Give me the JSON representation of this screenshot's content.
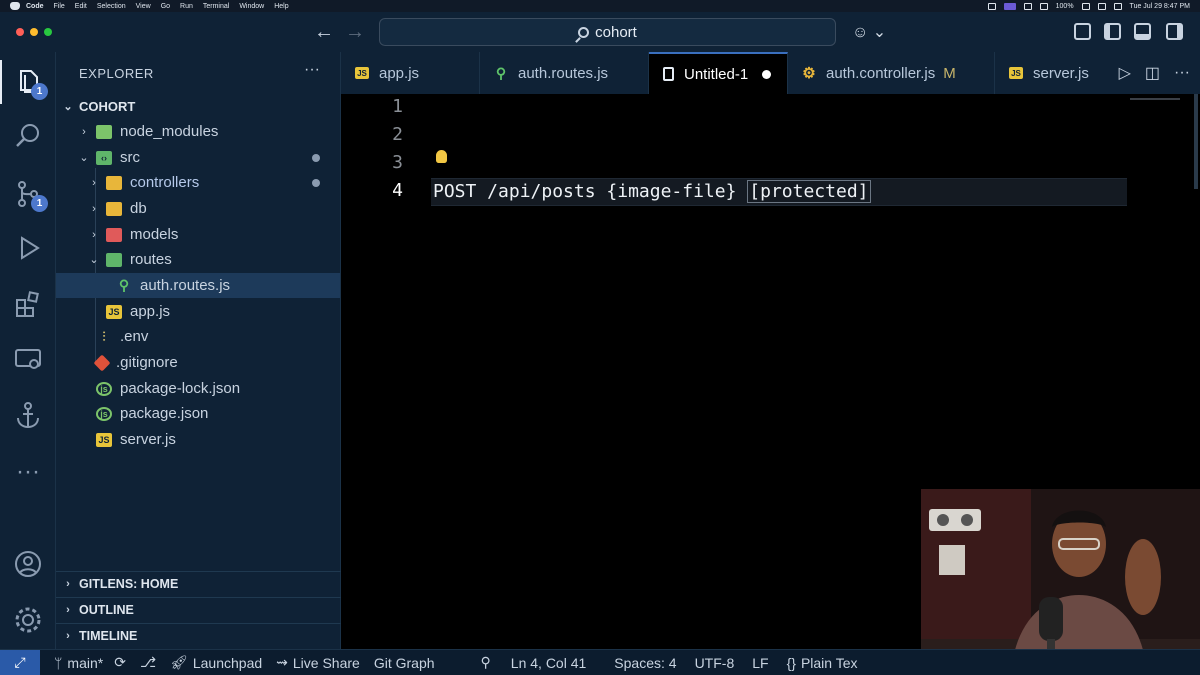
{
  "menubar": {
    "app": "Code",
    "items": [
      "File",
      "Edit",
      "Selection",
      "View",
      "Go",
      "Run",
      "Terminal",
      "Window",
      "Help"
    ],
    "battery": "100%",
    "clock": "Tue Jul 29  8:47 PM"
  },
  "titlebar": {
    "search": "cohort"
  },
  "activity": {
    "explorer_badge": "1",
    "scm_badge": "1"
  },
  "sidebar": {
    "title": "EXPLORER",
    "more": "···",
    "root": "COHORT",
    "items": [
      {
        "label": "node_modules"
      },
      {
        "label": "src"
      },
      {
        "label": "controllers"
      },
      {
        "label": "db"
      },
      {
        "label": "models"
      },
      {
        "label": "routes"
      },
      {
        "label": "auth.routes.js"
      },
      {
        "label": "app.js"
      },
      {
        "label": ".env"
      },
      {
        "label": ".gitignore"
      },
      {
        "label": "package-lock.json"
      },
      {
        "label": "package.json"
      },
      {
        "label": "server.js"
      }
    ],
    "sections": [
      "GITLENS: HOME",
      "OUTLINE",
      "TIMELINE"
    ]
  },
  "tabs": [
    {
      "label": "app.js"
    },
    {
      "label": "auth.routes.js"
    },
    {
      "label": "Untitled-1"
    },
    {
      "label": "auth.controller.js",
      "flag": "M"
    },
    {
      "label": "server.js"
    }
  ],
  "editor": {
    "line_numbers": [
      "1",
      "2",
      "3",
      "4"
    ],
    "code_a": "POST /api/posts {image-file} ",
    "code_b": "[protected]"
  },
  "status": {
    "branch": "main*",
    "launchpad": "Launchpad",
    "liveshare": "Live Share",
    "gitgraph": "Git Graph",
    "position": "Ln 4, Col 41",
    "spaces": "Spaces: 4",
    "encoding": "UTF-8",
    "eol": "LF",
    "language": "Plain Tex"
  },
  "colors": {
    "accent": "#3a6fbf",
    "js_icon": "#e8c53a",
    "folder_green": "#7cc46a",
    "folder_red": "#e05a5a",
    "folder_yellow": "#e8b63a"
  }
}
